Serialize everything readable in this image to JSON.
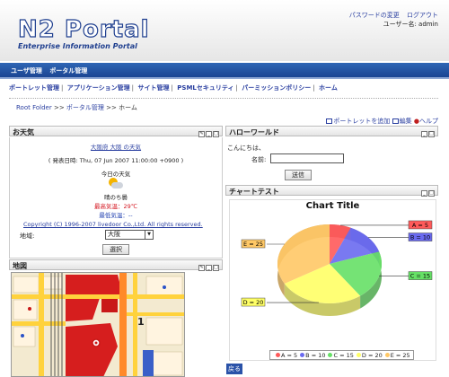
{
  "header": {
    "logo_line1": "N2 Portal",
    "logo_line2": "Enterprise Information Portal",
    "links": [
      "パスワードの変更",
      "ログアウト"
    ],
    "username": "ユーザー名: admin"
  },
  "menubar": {
    "items": [
      "ユーザ管理",
      "ポータル管理"
    ]
  },
  "navbar": {
    "items": [
      "ポートレット管理",
      "アプリケーション管理",
      "サイト管理",
      "PSMLセキュリティ",
      "パーミッションポリシー",
      "ホーム"
    ]
  },
  "breadcrumb": {
    "items": [
      "Root Folder",
      "ポータル管理",
      "ホーム"
    ],
    "separator": ">>"
  },
  "page_links": {
    "add_portlet": "ポートレットを追加",
    "edit": "編集",
    "help": "ヘルプ"
  },
  "weather": {
    "title": "お天気",
    "location_link": "大阪府 大阪 の天気",
    "published": "( 発表日時: Thu, 07 Jun 2007 11:00:00 +0900 )",
    "today_label": "今日の天気",
    "condition": "晴のち曇",
    "max_temp": "最高気温：29℃",
    "min_temp": "最低気温：--",
    "copyright": "Copyright (C) 1996-2007 livedoor Co.,Ltd. All rights reserved.",
    "region_label": "地域:",
    "region_value": "大阪",
    "select_button": "選択"
  },
  "map": {
    "title": "地図"
  },
  "hello": {
    "title": "ハローワールド",
    "greeting": "こんにちは、",
    "name_label": "名前:",
    "name_value": "",
    "send_button": "送信"
  },
  "chart_portlet": {
    "title": "チャートテスト",
    "back_link": "戻る"
  },
  "colors": {
    "menubar": "#1b4592",
    "link": "#2a3fa0",
    "max_temp": "#d4141e",
    "min_temp": "#1f3fb0"
  },
  "chart_data": {
    "type": "pie",
    "title": "Chart Title",
    "categories": [
      "A",
      "B",
      "C",
      "D",
      "E"
    ],
    "values": [
      5,
      10,
      15,
      20,
      25
    ],
    "labels": [
      "A = 5",
      "B = 10",
      "C = 15",
      "D = 20",
      "E = 25"
    ],
    "colors": [
      "#ff5a5a",
      "#6a6af0",
      "#66e066",
      "#ffff66",
      "#ffc866"
    ],
    "legend": "bottom"
  }
}
